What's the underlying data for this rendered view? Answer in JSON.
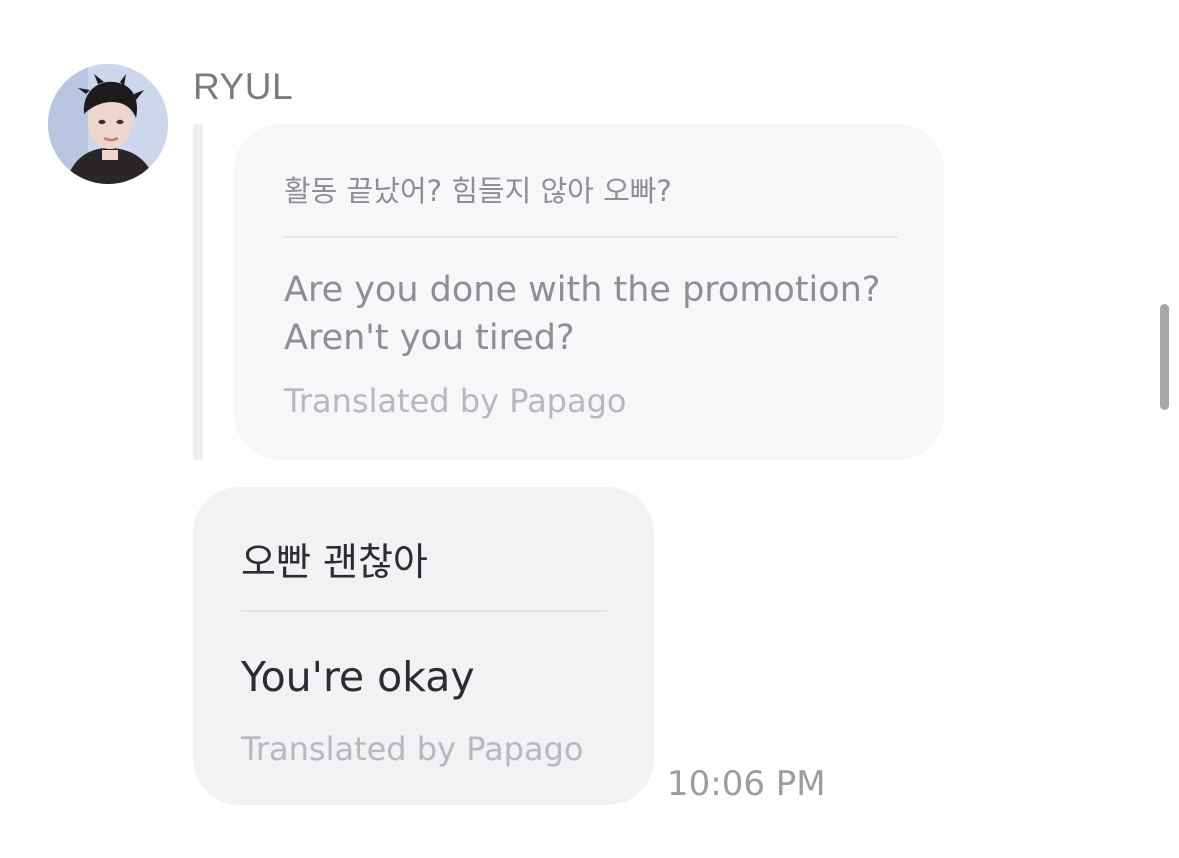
{
  "sender": {
    "name": "RYUL",
    "avatar_icon": "profile-photo"
  },
  "quoted_message": {
    "original": "활동 끝났어? 힘들지 않아 오빠?",
    "translation_line1": "Are you done with the promotion?",
    "translation_line2": "Aren't you tired?",
    "footer": "Translated by Papago"
  },
  "reply_message": {
    "original": "오빤 괜찮아",
    "translation": "You're okay",
    "footer": "Translated by Papago"
  },
  "timestamp": "10:06 PM",
  "colors": {
    "bubble_quoted": "#f7f7f9",
    "bubble_reply": "#f2f2f5",
    "text_dark": "#2c2c31",
    "text_muted": "#8e8e94"
  }
}
